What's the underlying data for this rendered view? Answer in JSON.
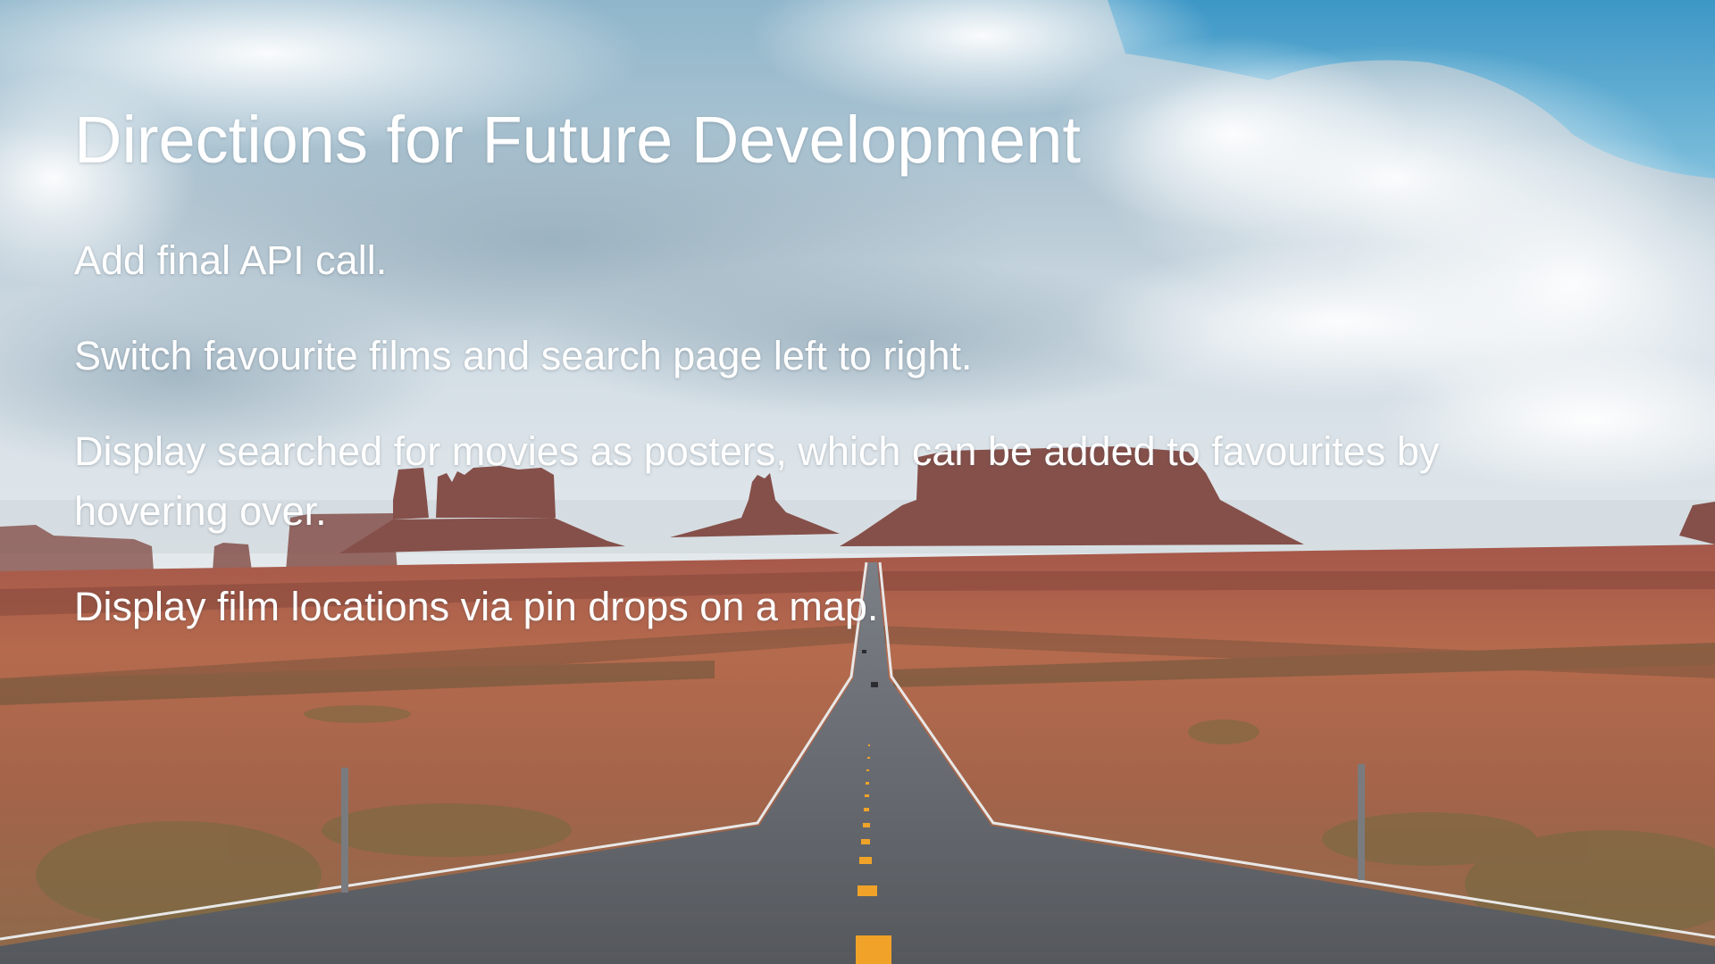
{
  "slide": {
    "title": "Directions for Future Development",
    "bullets": [
      {
        "text": "Add final API call."
      },
      {
        "text": "Switch favourite films and search page left to right."
      },
      {
        "text": "Display searched for movies as posters, which can be added to favourites by hovering over."
      },
      {
        "text": "Display film locations via pin drops on a map."
      }
    ]
  },
  "background": {
    "description_icon": "desert-road-photo",
    "colors": {
      "sky_top": "#4f9fc8",
      "sky_haze": "#c7d5df",
      "cloud": "#f3f6f8",
      "desert": "#b8674a",
      "road": "#5e6166",
      "road_line": "#f0a328",
      "mesa": "#8a4e45"
    }
  }
}
